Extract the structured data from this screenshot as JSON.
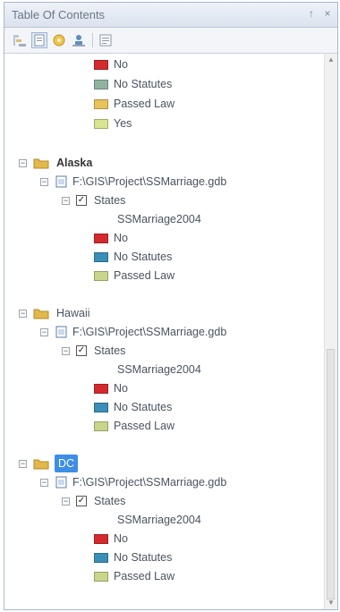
{
  "window": {
    "title": "Table Of Contents",
    "pin_glyph": "↑",
    "close_glyph": "×"
  },
  "toolbar": {
    "buttons": [
      "list-by-drawing-order-icon",
      "list-by-source-icon",
      "list-by-visibility-icon",
      "list-by-selection-icon",
      "options-icon"
    ]
  },
  "legend": {
    "no": "No",
    "no_statutes": "No Statutes",
    "passed_law": "Passed Law",
    "yes": "Yes"
  },
  "colors": {
    "no": "#d42a2e",
    "no_statutes": "#3a8fb7",
    "no_statutes_top": "#8fb3a0",
    "passed_law": "#e8c25a",
    "passed_law_lower": "#c9d58a",
    "yes": "#d9e48f",
    "folder": "#e2b84a",
    "selection": "#3d8ee6"
  },
  "groups": [
    {
      "name": "Alaska",
      "source": "F:\\GIS\\Project\\SSMarriage.gdb",
      "layer": "States",
      "field": "SSMarriage2004"
    },
    {
      "name": "Hawaii",
      "source": "F:\\GIS\\Project\\SSMarriage.gdb",
      "layer": "States",
      "field": "SSMarriage2004"
    },
    {
      "name": "DC",
      "source": "F:\\GIS\\Project\\SSMarriage.gdb",
      "layer": "States",
      "field": "SSMarriage2004"
    }
  ]
}
